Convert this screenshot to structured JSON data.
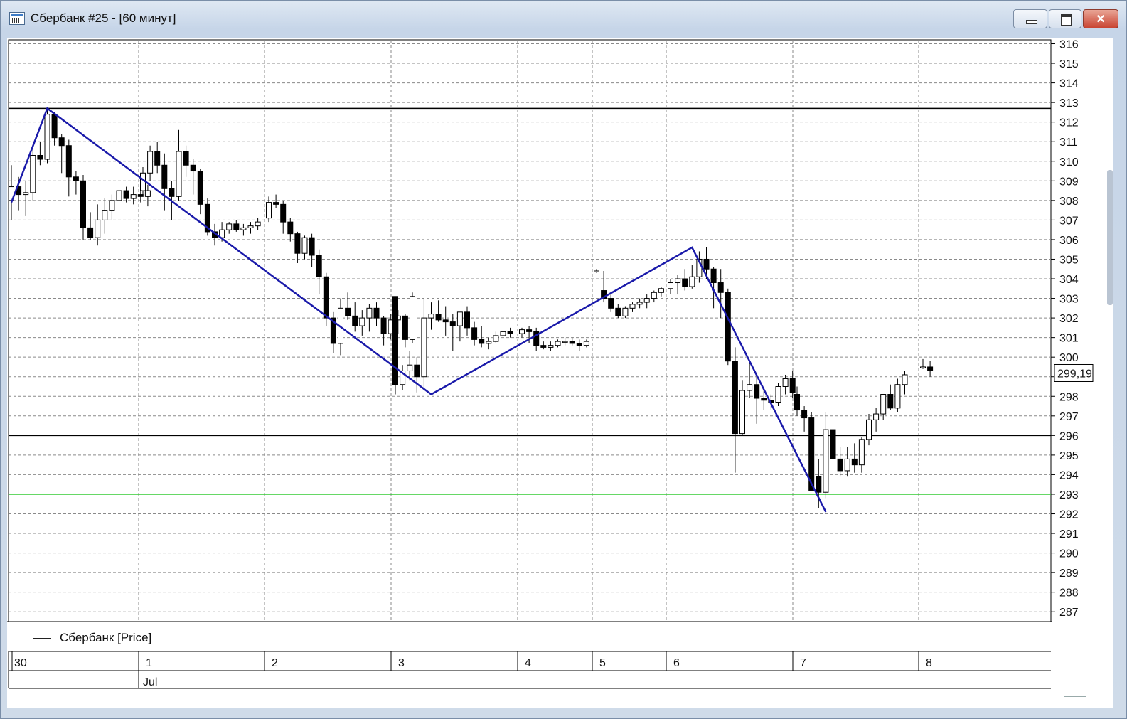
{
  "window": {
    "title": "Сбербанк #25 - [60 минут]",
    "buttons": {
      "minimize": "‒",
      "maximize": "❐",
      "close": "✕"
    }
  },
  "legend": {
    "label": "Сбербанк [Price]"
  },
  "price_label": "299,19",
  "colors": {
    "zigzag": "#1a1aaa",
    "support_green": "#33cc33",
    "level_lines": "#000000",
    "grid": "#888888",
    "candle_up": "#ffffff",
    "candle_down": "#000000"
  },
  "chart_data": {
    "type": "candlestick",
    "ylim": [
      286.5,
      316.2
    ],
    "y_ticks": [
      287,
      288,
      289,
      290,
      291,
      292,
      293,
      294,
      295,
      296,
      297,
      298,
      299,
      300,
      301,
      302,
      303,
      304,
      305,
      306,
      307,
      308,
      309,
      310,
      311,
      312,
      313,
      314,
      315,
      316
    ],
    "y_tick_labels_shown": [
      287,
      288,
      289,
      290,
      291,
      292,
      293,
      294,
      295,
      296,
      297,
      298,
      300,
      301,
      302,
      303,
      304,
      305,
      306,
      307,
      308,
      309,
      310,
      311,
      312,
      313,
      314,
      315,
      316
    ],
    "x_day_labels": [
      "30",
      "1",
      "2",
      "3",
      "4",
      "5",
      "6",
      "7",
      "8"
    ],
    "x_month_label": "Jul",
    "horizontal_levels": [
      {
        "price": 312.7,
        "color": "black"
      },
      {
        "price": 296.0,
        "color": "black"
      },
      {
        "price": 293.0,
        "color": "green"
      }
    ],
    "zigzag": [
      {
        "day": "30",
        "bar": 0,
        "price": 307.9
      },
      {
        "day": "30",
        "bar": 5,
        "price": 312.7
      },
      {
        "day": "3",
        "bar": 5,
        "price": 298.1
      },
      {
        "day": "6",
        "bar": 3,
        "price": 305.6
      },
      {
        "day": "7",
        "bar": 4,
        "price": 292.1
      }
    ],
    "days": [
      {
        "label": "30",
        "bars": [
          [
            308,
            309.8,
            307,
            308.7
          ],
          [
            308.7,
            309.2,
            307.5,
            308.3
          ],
          [
            308.3,
            309,
            307.2,
            308.4
          ],
          [
            308.4,
            310.6,
            308,
            310.3
          ],
          [
            310.3,
            311,
            309.8,
            310.1
          ],
          [
            310.1,
            312.7,
            309.9,
            312.4
          ],
          [
            312.4,
            312.5,
            310.8,
            311.2
          ],
          [
            311.2,
            311.4,
            309.4,
            310.8
          ],
          [
            310.8,
            311.1,
            308.2,
            309.2
          ],
          [
            309.2,
            309.5,
            308.3,
            309
          ],
          [
            309,
            309.3,
            306,
            306.6
          ],
          [
            306.6,
            307.4,
            306,
            306.1
          ],
          [
            306.1,
            307.8,
            305.7,
            307
          ],
          [
            307,
            308.1,
            306.3,
            307.5
          ],
          [
            307.5,
            308.3,
            307,
            308
          ],
          [
            308,
            308.7,
            307.9,
            308.5
          ],
          [
            308.5,
            308.7,
            307.9,
            308.1
          ],
          [
            308.1,
            308.7,
            307.8,
            308.3
          ],
          [
            308.3,
            308.5,
            307.9,
            308.2
          ],
          [
            308.2,
            308.8,
            307.7,
            308.5
          ]
        ]
      },
      {
        "label": "1",
        "bars": [
          [
            308.5,
            309.7,
            308.2,
            309.4
          ],
          [
            309.4,
            310.8,
            309,
            310.5
          ],
          [
            310.5,
            311,
            309.4,
            309.8
          ],
          [
            309.8,
            310.4,
            307.5,
            308.6
          ],
          [
            308.6,
            309,
            307,
            308.2
          ],
          [
            308.2,
            311.6,
            308,
            310.5
          ],
          [
            310.5,
            310.8,
            309.2,
            309.8
          ],
          [
            309.8,
            310.1,
            308.3,
            309.5
          ],
          [
            309.5,
            309.6,
            307.3,
            307.8
          ],
          [
            307.8,
            308.1,
            306.2,
            306.4
          ],
          [
            306.4,
            306.8,
            305.7,
            306.1
          ],
          [
            306.1,
            306.9,
            305.9,
            306.5
          ],
          [
            306.5,
            306.9,
            306.3,
            306.8
          ],
          [
            306.8,
            307,
            306.4,
            306.5
          ],
          [
            306.5,
            306.8,
            306.2,
            306.6
          ],
          [
            306.6,
            306.9,
            306.3,
            306.7
          ],
          [
            306.7,
            307.1,
            306.5,
            306.9
          ]
        ]
      },
      {
        "label": "2",
        "bars": [
          [
            307.1,
            308.2,
            306.9,
            307.9
          ],
          [
            307.9,
            308.3,
            307.6,
            307.8
          ],
          [
            307.8,
            308,
            306.3,
            306.9
          ],
          [
            306.9,
            307.1,
            305.9,
            306.3
          ],
          [
            306.3,
            306.4,
            304.8,
            305.3
          ],
          [
            305.3,
            306.2,
            305,
            306.1
          ],
          [
            306.1,
            306.3,
            304.6,
            305.2
          ],
          [
            305.2,
            305.5,
            303.2,
            304.1
          ],
          [
            304.1,
            304.3,
            301.6,
            302
          ],
          [
            302,
            302.3,
            300.2,
            300.7
          ],
          [
            300.7,
            303,
            300.1,
            302.5
          ],
          [
            302.5,
            303.3,
            301.9,
            302.1
          ],
          [
            302.1,
            302.8,
            301.3,
            301.6
          ],
          [
            301.6,
            302.4,
            301.1,
            302
          ],
          [
            302,
            302.7,
            301.3,
            302.5
          ],
          [
            302.5,
            302.8,
            301.6,
            302
          ],
          [
            302,
            302.1,
            300.6,
            301.2
          ],
          [
            301.2,
            302.2,
            300.9,
            301.9
          ],
          [
            301.9,
            302.4,
            301.2,
            302.1
          ],
          [
            302.1,
            302.2,
            300.5,
            300.9
          ],
          [
            300.9,
            303.3,
            300.7,
            303.1
          ]
        ]
      },
      {
        "label": "3",
        "bars": [
          [
            303.1,
            303.1,
            298.1,
            298.6
          ],
          [
            298.6,
            299.6,
            298.3,
            299.3
          ],
          [
            299.3,
            300.3,
            298.8,
            299.6
          ],
          [
            299.6,
            300,
            298.2,
            299
          ],
          [
            299,
            303,
            298.4,
            302
          ],
          [
            302,
            302.8,
            301.4,
            302.2
          ],
          [
            302.2,
            302.9,
            301.8,
            301.9
          ],
          [
            301.9,
            302.6,
            301.1,
            301.8
          ],
          [
            301.8,
            302.2,
            300.3,
            301.6
          ],
          [
            301.6,
            302,
            300.8,
            302.3
          ],
          [
            302.3,
            302.6,
            301.1,
            301.5
          ],
          [
            301.5,
            301.8,
            300.6,
            300.9
          ],
          [
            300.9,
            301.6,
            300.5,
            300.7
          ],
          [
            300.7,
            301,
            300.4,
            300.8
          ],
          [
            300.8,
            301.3,
            300.7,
            301.1
          ],
          [
            301.1,
            301.6,
            300.9,
            301.3
          ],
          [
            301.3,
            301.5,
            301,
            301.2
          ]
        ]
      },
      {
        "label": "4",
        "bars": [
          [
            301.2,
            301.5,
            301,
            301.4
          ],
          [
            301.4,
            301.6,
            300.7,
            301.3
          ],
          [
            301.3,
            301.5,
            300.3,
            300.6
          ],
          [
            300.6,
            300.8,
            300.4,
            300.5
          ],
          [
            300.5,
            300.8,
            300.3,
            300.6
          ],
          [
            300.6,
            300.9,
            300.5,
            300.8
          ],
          [
            300.8,
            301,
            300.6,
            300.8
          ],
          [
            300.8,
            301,
            300.6,
            300.7
          ],
          [
            300.7,
            300.9,
            300.3,
            300.6
          ],
          [
            300.6,
            300.9,
            300.5,
            300.8
          ]
        ]
      },
      {
        "label": "5",
        "bars": [
          [
            304.4,
            304.5,
            304.3,
            304.4
          ],
          [
            303.4,
            304.4,
            302.8,
            303
          ],
          [
            303,
            303.2,
            302.3,
            302.5
          ],
          [
            302.5,
            302.7,
            302,
            302.1
          ],
          [
            302.1,
            302.6,
            302,
            302.5
          ],
          [
            302.5,
            302.8,
            302.3,
            302.7
          ],
          [
            302.7,
            303,
            302.5,
            302.8
          ],
          [
            302.8,
            303.2,
            302.5,
            303
          ],
          [
            303,
            303.4,
            302.8,
            303.3
          ],
          [
            303.3,
            303.6,
            303.1,
            303.5
          ]
        ]
      },
      {
        "label": "6",
        "bars": [
          [
            303.5,
            304,
            303.2,
            303.8
          ],
          [
            303.8,
            304.2,
            303.2,
            304
          ],
          [
            304,
            304.5,
            303.4,
            303.6
          ],
          [
            303.6,
            304.7,
            303.5,
            304.1
          ],
          [
            304.1,
            305.4,
            303.8,
            305
          ],
          [
            305,
            305.6,
            304,
            304.5
          ],
          [
            304.5,
            304.6,
            302.5,
            303.8
          ],
          [
            303.8,
            304.5,
            302,
            303.3
          ],
          [
            303.3,
            303.5,
            299.6,
            299.8
          ],
          [
            299.8,
            300.5,
            294.1,
            296.1
          ],
          [
            296.1,
            298.8,
            296,
            298.3
          ],
          [
            298.3,
            299.8,
            297.9,
            298.6
          ],
          [
            298.6,
            299.1,
            296.6,
            297.9
          ],
          [
            297.9,
            298.4,
            297.3,
            297.8
          ],
          [
            297.8,
            298.1,
            297.3,
            297.7
          ],
          [
            297.7,
            298.7,
            297.5,
            298.5
          ],
          [
            298.5,
            299.1,
            298.1,
            298.9
          ],
          [
            298.9,
            299.3,
            297.9,
            298.2
          ]
        ]
      },
      {
        "label": "7",
        "bars": [
          [
            298.1,
            298.5,
            297,
            297.3
          ],
          [
            297.3,
            297.5,
            296.2,
            296.9
          ],
          [
            296.9,
            297.2,
            293.4,
            293.2
          ],
          [
            293.9,
            294.8,
            292.3,
            293.1
          ],
          [
            293.1,
            297.2,
            292.8,
            296.3
          ],
          [
            296.3,
            297.1,
            293.3,
            294.8
          ],
          [
            294.8,
            295.4,
            293.9,
            294.2
          ],
          [
            294.2,
            295.4,
            293.9,
            294.8
          ],
          [
            294.8,
            295.6,
            294.1,
            294.5
          ],
          [
            294.5,
            295.9,
            294.1,
            295.8
          ],
          [
            295.8,
            297.1,
            295.5,
            296.8
          ],
          [
            296.8,
            297.4,
            296.2,
            297.1
          ],
          [
            297.1,
            298.1,
            296.8,
            298.1
          ],
          [
            298.1,
            298.6,
            297.3,
            297.4
          ],
          [
            297.4,
            298.9,
            297.2,
            298.6
          ],
          [
            298.6,
            299.3,
            298.1,
            299.1
          ]
        ]
      },
      {
        "label": "8",
        "bars": [
          [
            299.5,
            299.9,
            299.4,
            299.5
          ],
          [
            299.5,
            299.8,
            299,
            299.3
          ]
        ]
      }
    ]
  }
}
